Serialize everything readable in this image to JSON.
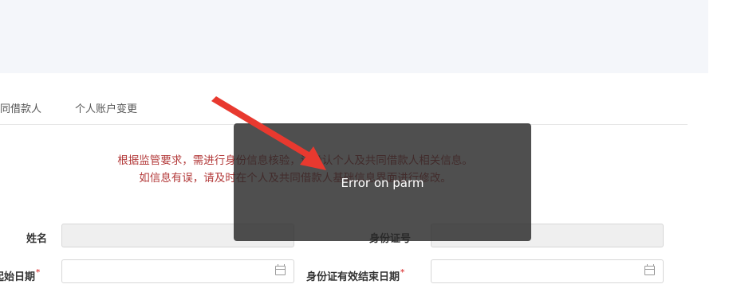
{
  "tabs": [
    "同借款人",
    "个人账户变更"
  ],
  "notice": {
    "line1": "根据监管要求，需进行身份信息核验，请确认个人及共同借款人相关信息。",
    "line2": "如信息有误，请及时在个人及共同借款人基础信息界面进行修改。"
  },
  "form": {
    "name_label": "姓名",
    "name_value": "",
    "id_number_label": "身份证号",
    "id_number_value": "",
    "start_date_label": "起始日期",
    "start_date_value": "",
    "end_date_label": "身份证有效结束日期",
    "end_date_value": "",
    "required_mark": "*"
  },
  "toast": {
    "message": "Error on parm"
  },
  "icons": {
    "calendar": "calendar-icon",
    "arrow": "red-annotation-arrow"
  },
  "colors": {
    "notice": "#b33a3a",
    "required": "#e05050",
    "arrow": "#e8392f",
    "toast_bg": "#3a3a3a",
    "banner": "#f4f6fa"
  }
}
